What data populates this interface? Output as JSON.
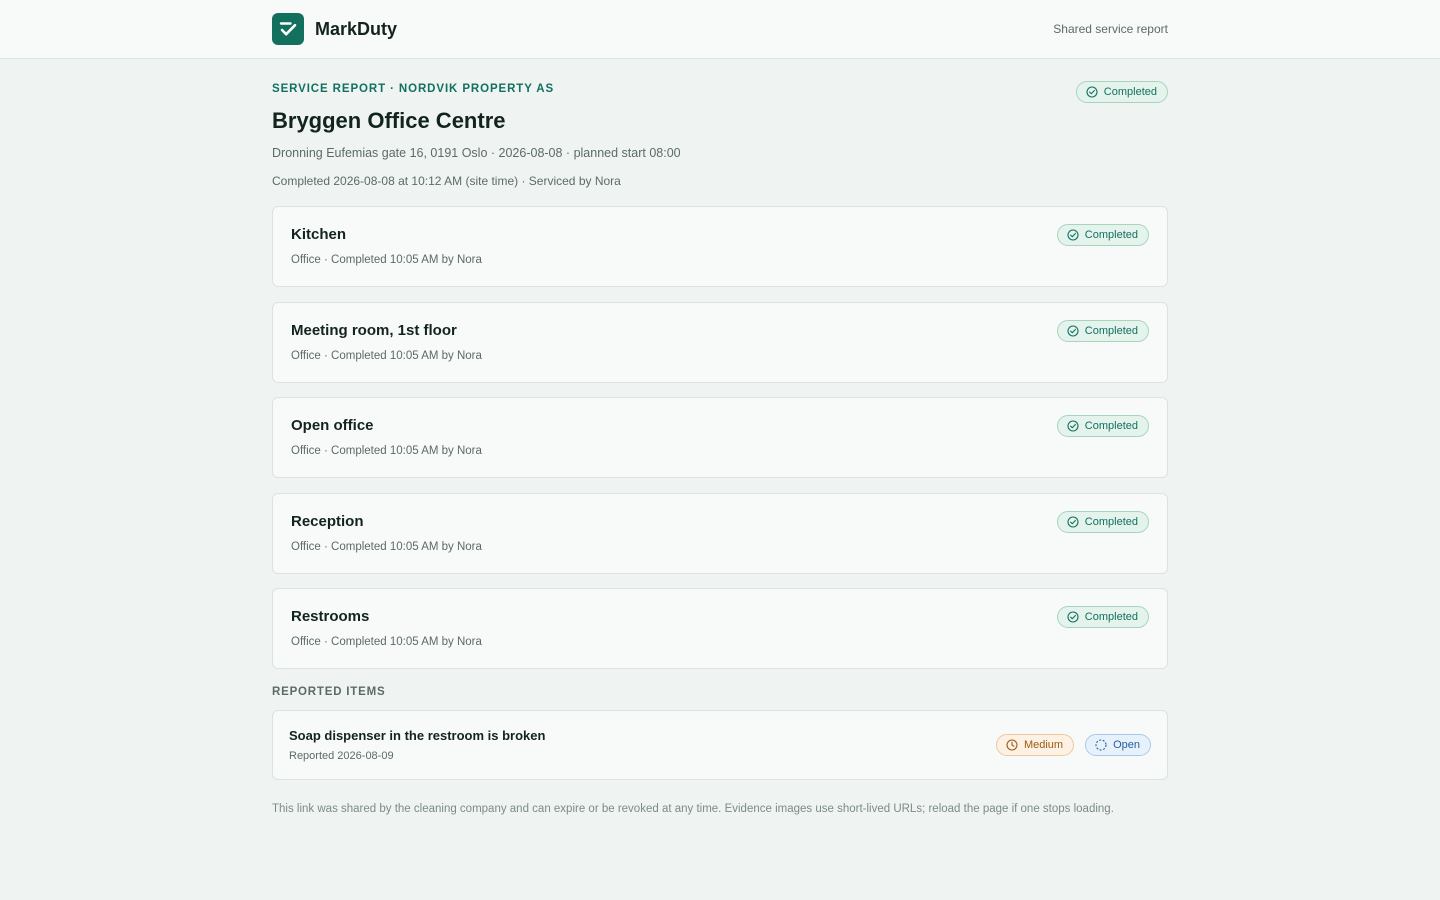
{
  "header": {
    "brand": "MarkDuty",
    "right_text": "Shared service report"
  },
  "report": {
    "eyebrow": "SERVICE REPORT · NORDVIK PROPERTY AS",
    "title": "Bryggen Office Centre",
    "meta": "Dronning Eufemias gate 16, 0191 Oslo · 2026-08-08 · planned start 08:00",
    "completion": "Completed 2026-08-08 at 10:12 AM (site time) · Serviced by Nora",
    "status": "Completed"
  },
  "rooms": [
    {
      "name": "Kitchen",
      "meta": "Office · Completed 10:05 AM by Nora",
      "status": "Completed"
    },
    {
      "name": "Meeting room, 1st floor",
      "meta": "Office · Completed 10:05 AM by Nora",
      "status": "Completed"
    },
    {
      "name": "Open office",
      "meta": "Office · Completed 10:05 AM by Nora",
      "status": "Completed"
    },
    {
      "name": "Reception",
      "meta": "Office · Completed 10:05 AM by Nora",
      "status": "Completed"
    },
    {
      "name": "Restrooms",
      "meta": "Office · Completed 10:05 AM by Nora",
      "status": "Completed"
    }
  ],
  "reported": {
    "label": "REPORTED ITEMS",
    "items": [
      {
        "title": "Soap dispenser in the restroom is broken",
        "meta": "Reported 2026-08-09",
        "priority": "Medium",
        "status": "Open"
      }
    ]
  },
  "footer": "This link was shared by the cleaning company and can expire or be revoked at any time. Evidence images use short-lived URLs; reload the page if one stops loading.",
  "colors": {
    "brand": "#13705f",
    "background": "#eff4f2",
    "completed": "#13705f",
    "medium": "#9a5b12",
    "open": "#245e9e"
  }
}
